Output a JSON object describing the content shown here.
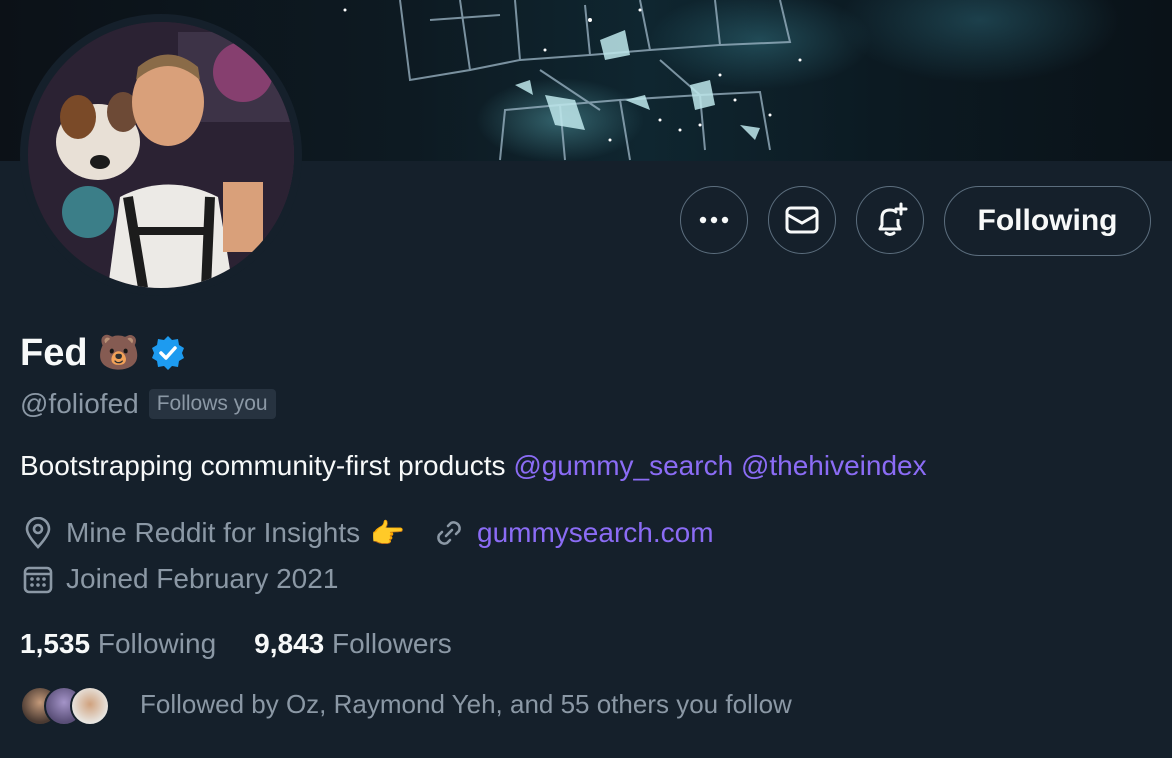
{
  "profile": {
    "display_name": "Fed",
    "name_emoji": "🐻",
    "handle": "@foliofed",
    "follows_you_label": "Follows you",
    "bio_text": "Bootstrapping community-first products ",
    "bio_mentions": [
      "@gummy_search",
      "@thehiveindex"
    ],
    "location": "Mine Reddit for Insights",
    "location_emoji": "👉",
    "website": "gummysearch.com",
    "joined": "Joined February 2021",
    "following_count": "1,535",
    "following_label": "Following",
    "followers_count": "9,843",
    "followers_label": "Followers",
    "followed_by": "Followed by Oz, Raymond Yeh, and 55 others you follow"
  },
  "actions": {
    "more_icon": "more-icon",
    "message_icon": "envelope-icon",
    "notify_icon": "bell-plus-icon",
    "following_button": "Following"
  },
  "colors": {
    "background": "#15202b",
    "link": "#8b6cf5",
    "verified": "#1d9bf0",
    "muted_text": "#8b98a5"
  }
}
